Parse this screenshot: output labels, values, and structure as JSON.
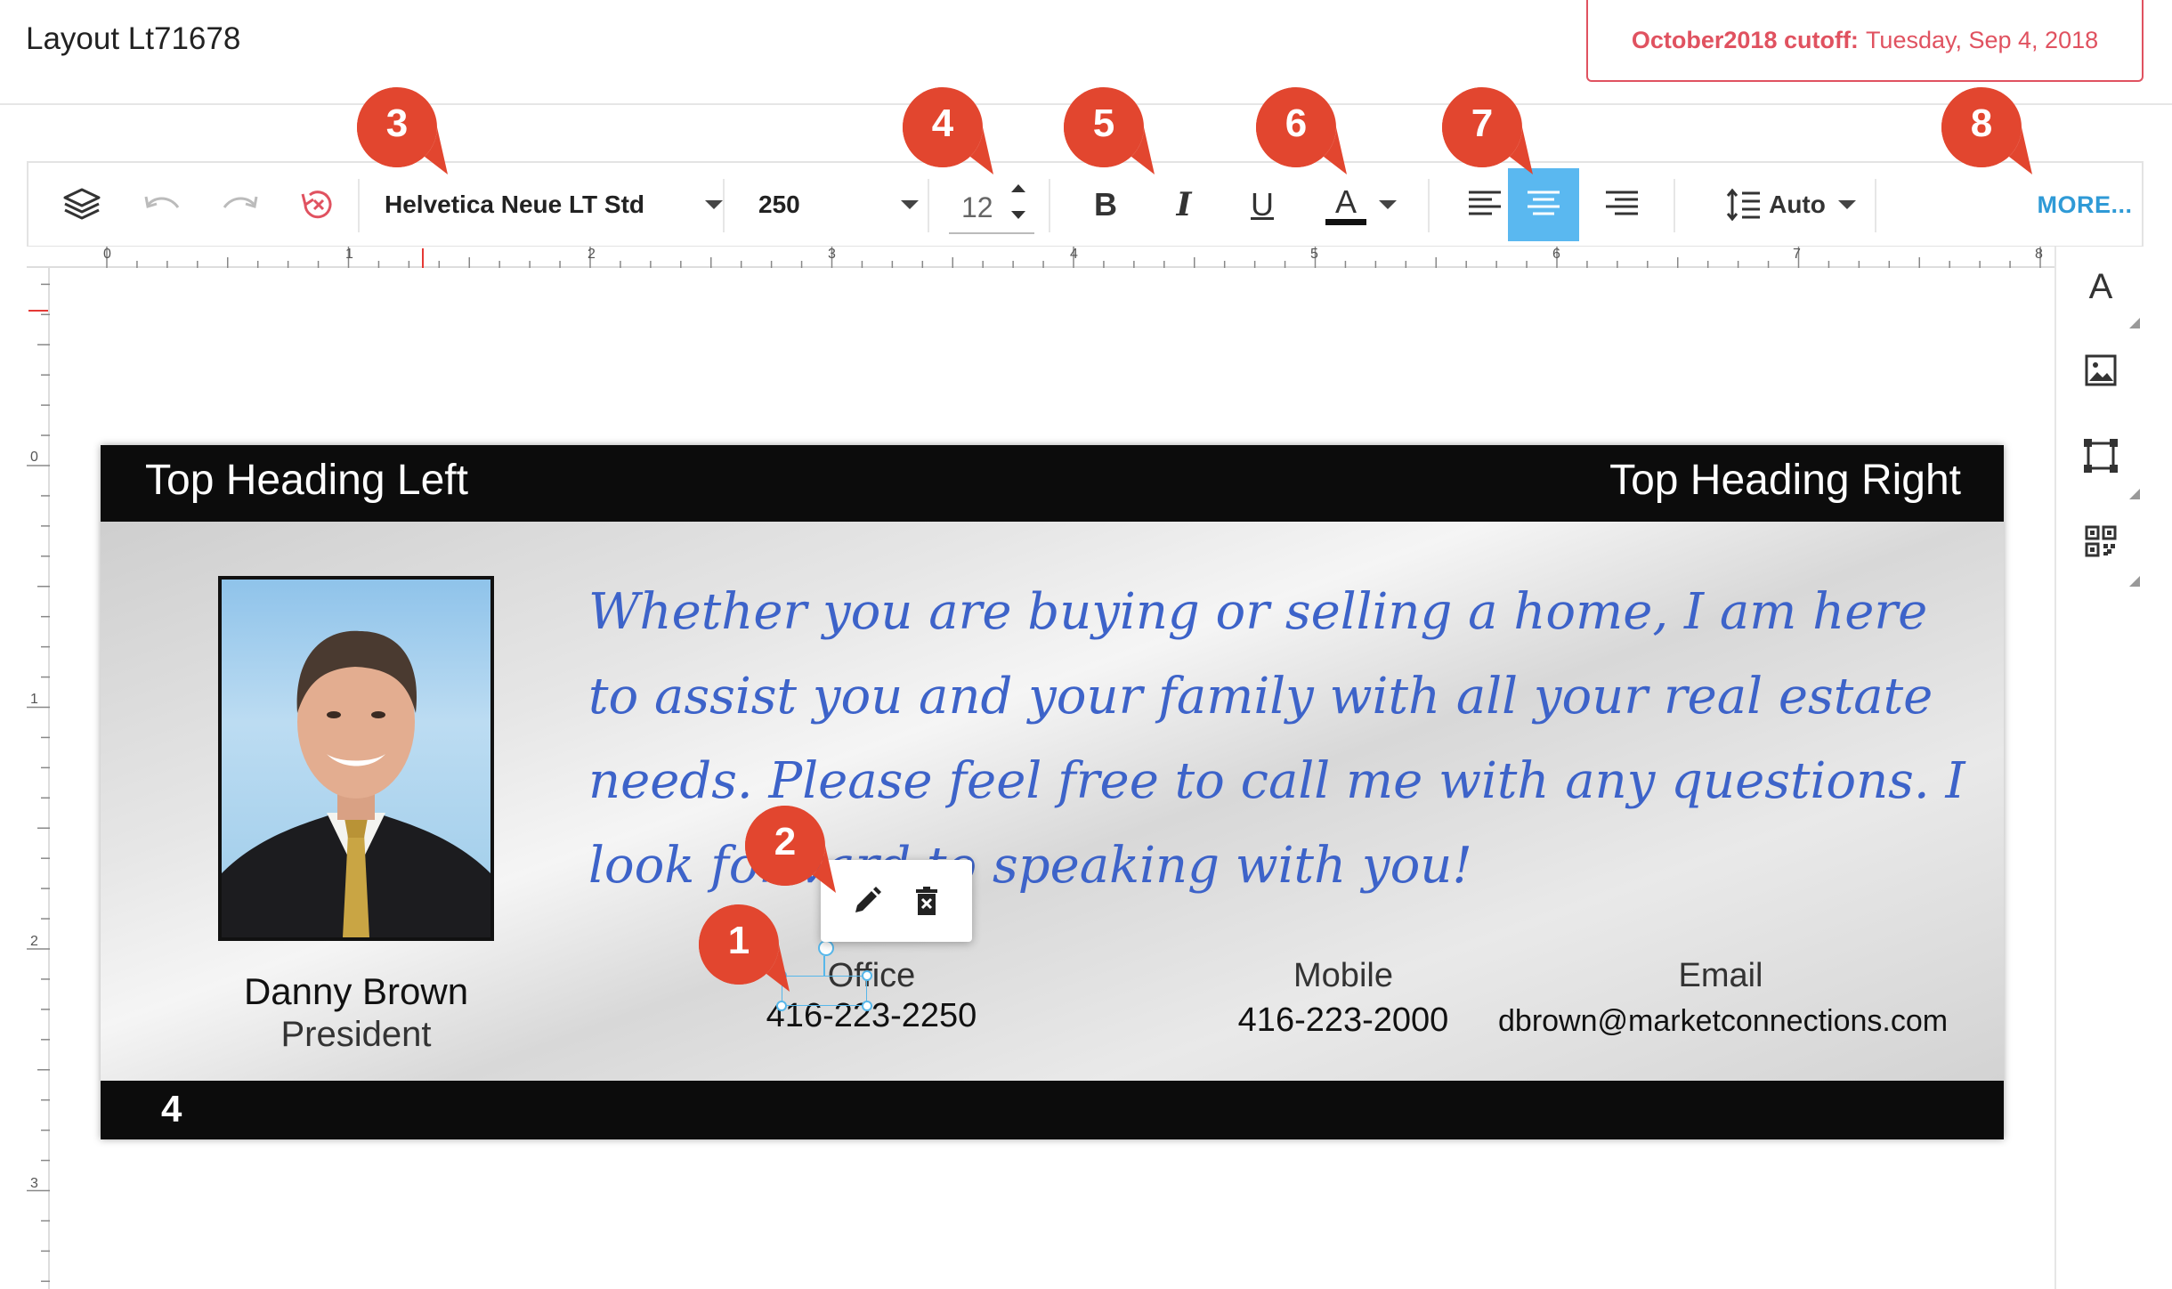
{
  "header": {
    "layout_title": "Layout Lt71678",
    "cutoff_label": "October2018 cutoff:",
    "cutoff_date": "Tuesday, Sep 4, 2018"
  },
  "toolbar": {
    "font_family": "Helvetica Neue LT Std",
    "font_weight": "250",
    "font_size": "12",
    "bold_label": "B",
    "italic_label": "I",
    "underline_label": "U",
    "text_color_label": "A",
    "text_color": "#111111",
    "line_height_label": "Auto",
    "more_label": "MORE...",
    "active_alignment": "center"
  },
  "rulers": {
    "horizontal_ticks": [
      "0",
      "1",
      "2",
      "3",
      "4",
      "5",
      "6",
      "7",
      "8"
    ],
    "vertical_ticks": [
      "0",
      "1",
      "2",
      "3"
    ]
  },
  "side_tools": {
    "text_tool_label": "A"
  },
  "card": {
    "top_heading_left": "Top Heading Left",
    "top_heading_right": "Top Heading Right",
    "quote": "Whether you are buying or selling a home, I am here to assist you and your family with all your real estate needs. Please feel free to call me with any questions. I look forward to speaking with you!",
    "name": "Danny Brown",
    "role": "President",
    "office_label": "Office",
    "office_phone": "416-223-2250",
    "mobile_label": "Mobile",
    "mobile_phone": "416-223-2000",
    "email_label": "Email",
    "email": "dbrown@marketconnections.com",
    "page_number": "4"
  },
  "callouts": [
    "1",
    "2",
    "3",
    "4",
    "5",
    "6",
    "7",
    "8"
  ],
  "colors": {
    "accent_blue": "#5ab8f0",
    "callout_red": "#e2462f",
    "cutoff_red": "#e05260",
    "quote_blue": "#3d63c9",
    "more_link": "#2f9ad6"
  }
}
